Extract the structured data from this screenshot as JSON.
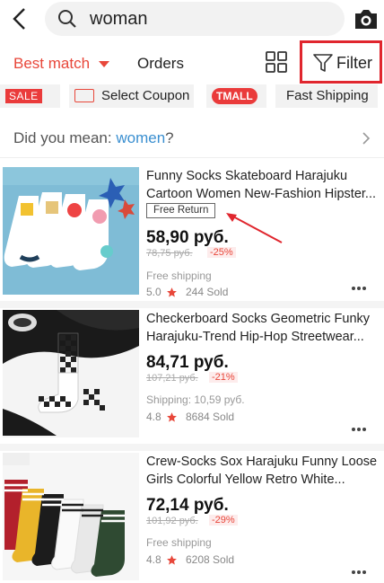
{
  "search": {
    "query": "woman"
  },
  "sort": {
    "best_match": "Best match",
    "orders": "Orders",
    "filter": "Filter"
  },
  "tags": {
    "sale": "SALE",
    "coupon": "Select Coupon",
    "tmall": "TMALL",
    "fast": "Fast Shipping"
  },
  "did_you_mean": {
    "prefix": "Did you mean: ",
    "suggestion": "women",
    "suffix": "?"
  },
  "products": [
    {
      "title": "Funny Socks Skateboard Harajuku\nCartoon Women New-Fashion Hipster...",
      "badge": "Free Return",
      "price": "58,90 руб.",
      "old_price": "78,75 руб.",
      "discount": "-25%",
      "shipping": "Free shipping",
      "rating": "5.0",
      "sold": "244 Sold"
    },
    {
      "title": "Checkerboard Socks Geometric Funky\nHarajuku-Trend Hip-Hop Streetwear...",
      "price": "84,71 руб.",
      "old_price": "107,21 руб.",
      "discount": "-21%",
      "shipping": "Shipping: 10,59 руб.",
      "rating": "4.8",
      "sold": "8684 Sold"
    },
    {
      "title": "Crew-Socks Sox Harajuku Funny Loose\nGirls Colorful Yellow Retro White...",
      "price": "72,14 руб.",
      "old_price": "101,92 руб.",
      "discount": "-29%",
      "shipping": "Free shipping",
      "rating": "4.8",
      "sold": "6208 Sold"
    }
  ],
  "colors": {
    "accent": "#e8473a",
    "link": "#3a8fd0",
    "highlight": "#e0262e"
  },
  "icons": [
    "back-icon",
    "search-icon",
    "camera-icon",
    "grid-view-icon",
    "filter-icon",
    "coupon-icon",
    "chevron-right-icon",
    "star-icon",
    "more-icon"
  ]
}
